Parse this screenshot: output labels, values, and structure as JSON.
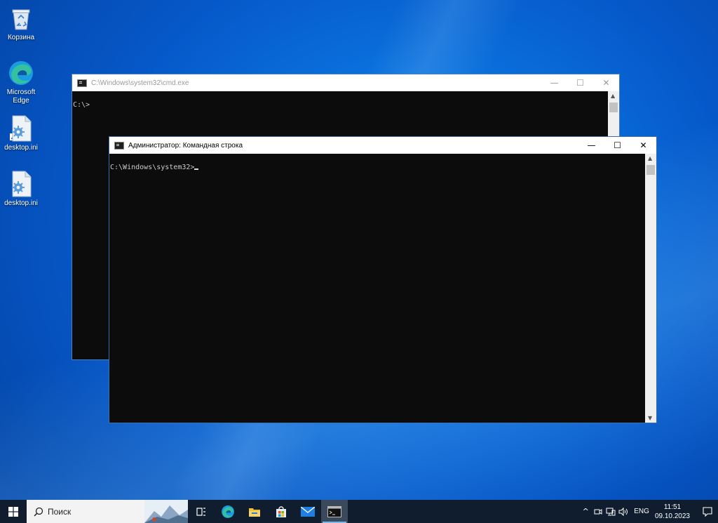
{
  "desktop": {
    "icons": [
      {
        "label": "Корзина",
        "icon": "recycle-bin-icon"
      },
      {
        "label": "Microsoft Edge",
        "icon": "edge-icon"
      },
      {
        "label": "desktop.ini",
        "icon": "settings-file-icon"
      },
      {
        "label": "desktop.ini",
        "icon": "settings-file-icon"
      }
    ]
  },
  "windows": {
    "back": {
      "title": "C:\\Windows\\system32\\cmd.exe",
      "prompt": "C:\\>"
    },
    "front": {
      "title": "Администратор: Командная строка",
      "prompt": "C:\\Windows\\system32>"
    },
    "buttons": {
      "minimize": "—",
      "maximize": "☐",
      "close": "✕"
    }
  },
  "taskbar": {
    "search_label": "Поиск",
    "apps": [
      "task-view-icon",
      "edge-icon",
      "file-explorer-icon",
      "store-icon",
      "mail-icon",
      "cmd-icon"
    ],
    "tray": {
      "chevron": "^",
      "lang": "ENG",
      "time": "11:51",
      "date": "09.10.2023"
    }
  },
  "colors": {
    "console_bg": "#0c0c0c",
    "taskbar_bg": "#0f1d2e",
    "accent": "#0a6fdc"
  }
}
